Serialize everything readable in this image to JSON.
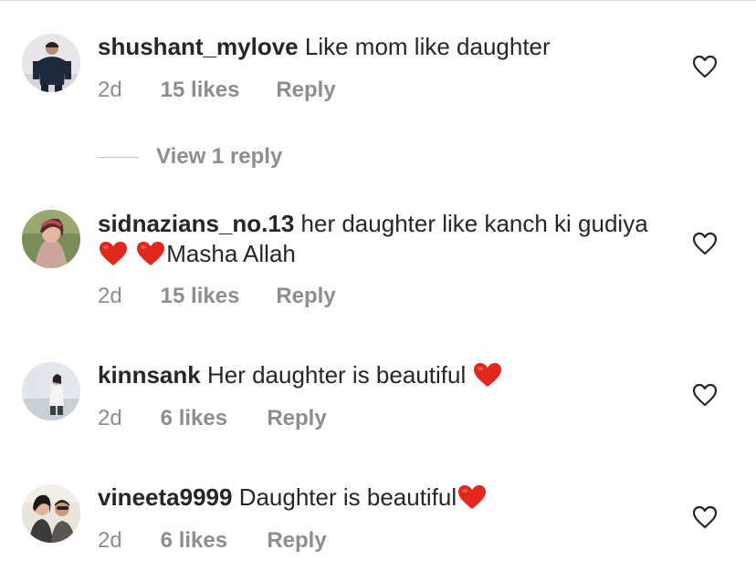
{
  "comments": [
    {
      "username": "shushant_mylove",
      "text": "Like mom like daughter",
      "time": "2d",
      "likes": "15 likes",
      "reply": "Reply"
    },
    {
      "username": "sidnazians_no.13",
      "text_before": "her daughter like kanch ki gudiya",
      "text_after": "Masha Allah",
      "time": "2d",
      "likes": "15 likes",
      "reply": "Reply"
    },
    {
      "username": "kinnsank",
      "text": "Her daughter is beautiful",
      "time": "2d",
      "likes": "6 likes",
      "reply": "Reply"
    },
    {
      "username": "vineeta9999",
      "text": "Daughter is beautiful",
      "time": "2d",
      "likes": "6 likes",
      "reply": "Reply"
    }
  ],
  "view_replies": "View 1 reply",
  "icons": {
    "like": "heart-outline-icon",
    "emoji": "red-heart-emoji"
  },
  "colors": {
    "text": "#262626",
    "secondary": "#8e8e8e",
    "emoji_heart": "#e0281f"
  }
}
